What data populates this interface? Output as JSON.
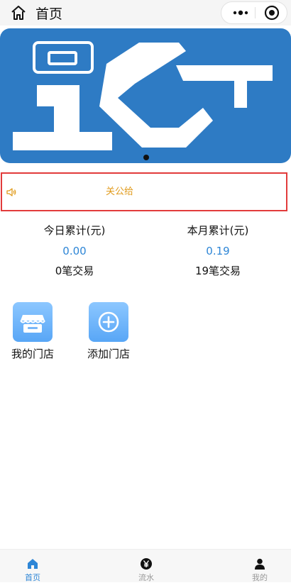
{
  "header": {
    "title": "首页",
    "home_icon": "home-icon",
    "more_icon": "more-dots-icon",
    "close_icon": "target-close-icon"
  },
  "banner": {
    "accent_color": "#2e7bc4",
    "active_slide": 1,
    "slide_count": 1
  },
  "notice": {
    "text": "关公给",
    "icon": "speaker-icon",
    "text_color": "#e09a1a"
  },
  "stats": {
    "today": {
      "label": "今日累计(元)",
      "amount": "0.00",
      "transactions": "0笔交易"
    },
    "month": {
      "label": "本月累计(元)",
      "amount": "0.19",
      "transactions": "19笔交易"
    }
  },
  "shortcuts": [
    {
      "label": "我的门店",
      "icon": "store-icon"
    },
    {
      "label": "添加门店",
      "icon": "add-circle-icon"
    }
  ],
  "tabbar": {
    "active": "home",
    "items": [
      {
        "label": "首页",
        "icon": "home-icon"
      },
      {
        "label": "流水",
        "icon": "yen-icon"
      },
      {
        "label": "我的",
        "icon": "user-icon"
      }
    ]
  }
}
